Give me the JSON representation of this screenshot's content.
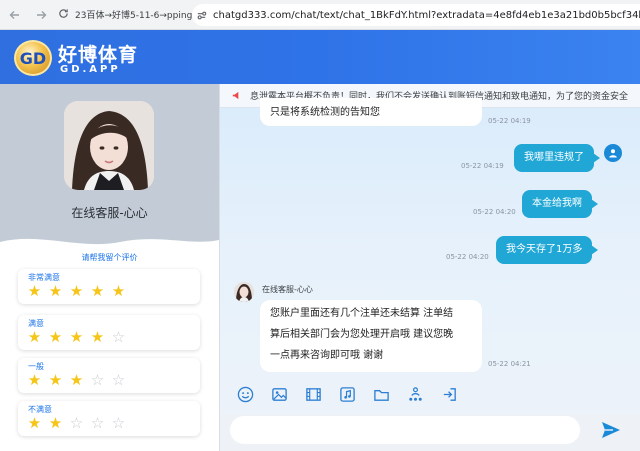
{
  "browser": {
    "tab_text": "23百体→好博5-11-6→pping2",
    "url": "chatgd333.com/chat/text/chat_1BkFdY.html?extradata=4e8fd4eb1e3a21bd0b5bcf34bd676780"
  },
  "header": {
    "logo_mark": "GD",
    "logo_title": "好博体育",
    "logo_sub": "GD.APP"
  },
  "sidebar": {
    "agent_name": "在线客服-心心",
    "rate_title": "请帮我留个评价",
    "ratings": [
      {
        "label": "非常满意",
        "stars": 5
      },
      {
        "label": "满意",
        "stars": 4
      },
      {
        "label": "一般",
        "stars": 3
      },
      {
        "label": "不满意",
        "stars": 2
      }
    ]
  },
  "chat": {
    "notice": "息泄露本平台概不负责！同时，我们不会发送确认到账短信通知和致电通知，为了您的资金安全",
    "messages": [
      {
        "from": "agent",
        "text": "只是将系统检测的告知您",
        "time": "05-22 04:19"
      },
      {
        "from": "user",
        "text": "我哪里违规了",
        "time": "05-22 04:19"
      },
      {
        "from": "user",
        "text": "本金给我啊",
        "time": "05-22 04:20"
      },
      {
        "from": "user",
        "text": "我今天存了1万多",
        "time": "05-22 04:20"
      },
      {
        "from": "agent",
        "text_lines": [
          "您账户里面还有几个注单还未结算 注单结",
          "算后相关部门会为您处理开启哦 建议您晚",
          "一点再来咨询即可哦 谢谢"
        ],
        "time": "05-22 04:21"
      }
    ],
    "agent_label": "在线客服-心心",
    "input_placeholder": ""
  },
  "toolbar_icons": [
    "emoji-icon",
    "image-icon",
    "video-icon",
    "audio-icon",
    "folder-icon",
    "transfer-agent-icon",
    "exit-icon"
  ],
  "colors": {
    "header_blue": "#2f6fe0",
    "bubble_blue": "#21a7d6",
    "star_gold": "#f5c518",
    "accent": "#1a73e8"
  }
}
